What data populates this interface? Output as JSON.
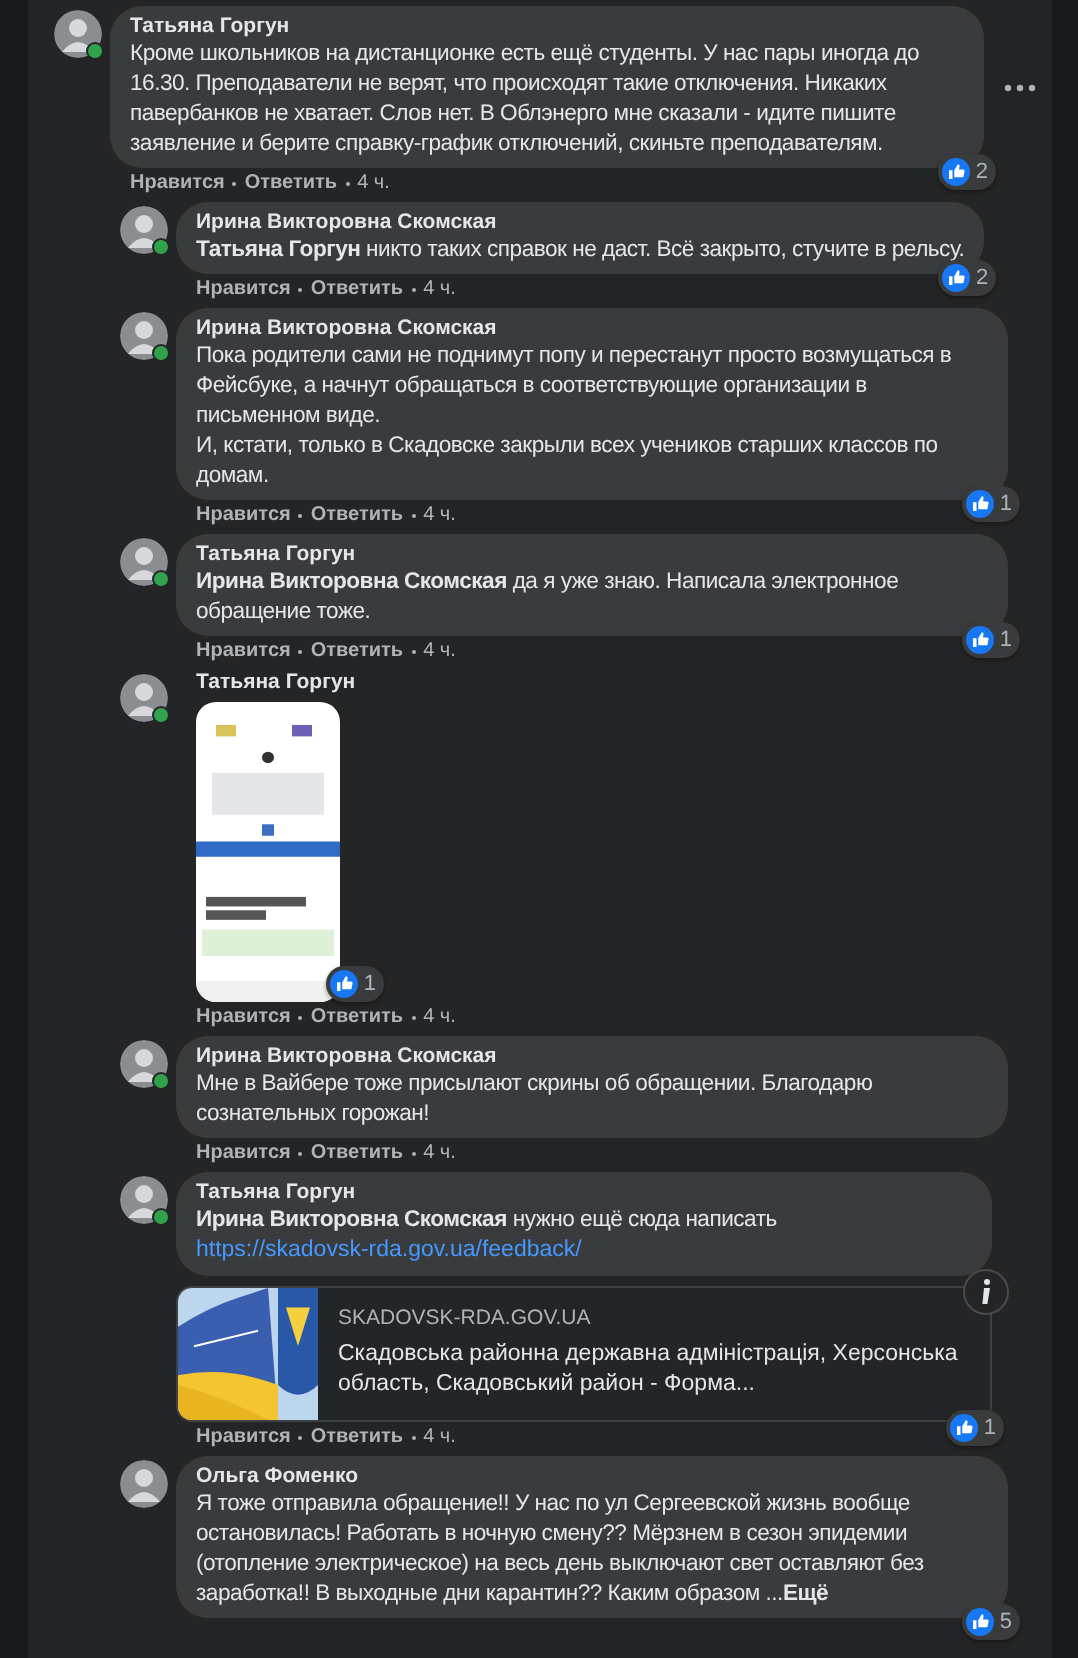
{
  "comments": [
    {
      "author": "Татьяна Горгун",
      "nested": false,
      "online": true,
      "text": "Кроме школьников на дистанционке есть ещё студенты. У нас пары иногда до 16.30. Преподаватели не верят, что происходят такие отключения. Никаких павербанков не хватает. Слов нет. В Облэнерго мне сказали - идите пишите заявление и берите справку-график отключений, скиньте преподавателям.",
      "more": true,
      "reactions": "2",
      "like": "Нравится",
      "reply": "Ответить",
      "time": "4 ч."
    },
    {
      "author": "Ирина Викторовна Скомская",
      "nested": true,
      "online": true,
      "text": "**Татьяна Горгун** никто таких справок не даст. Всё закрыто, стучите в рельсу.",
      "reactions": "2",
      "like": "Нравится",
      "reply": "Ответить",
      "time": "4 ч."
    },
    {
      "author": "Ирина Викторовна Скомская",
      "nested": true,
      "online": true,
      "text": "Пока родители сами не поднимут попу и перестанут просто возмущаться в Фейсбуке, а начнут обращаться в соответствующие организации в письменном виде.\nИ, кстати, только в Скадовске закрыли всех учеников старших классов по домам.",
      "reactions": "1",
      "like": "Нравится",
      "reply": "Ответить",
      "time": "4 ч."
    },
    {
      "author": "Татьяна Горгун",
      "nested": true,
      "online": true,
      "text": "**Ирина Викторовна Скомская** да я уже знаю. Написала электронное обращение тоже.",
      "reactions": "1",
      "like": "Нравится",
      "reply": "Ответить",
      "time": "4 ч."
    },
    {
      "author": "Татьяна Горгун",
      "nested": true,
      "online": true,
      "reactions": "1",
      "like": "Нравится",
      "reply": "Ответить",
      "time": "4 ч."
    },
    {
      "author": "Ирина Викторовна Скомская",
      "nested": true,
      "online": true,
      "text": "Мне в Вайбере тоже присылают скрины об обращении. Благодарю сознательных горожан!",
      "like": "Нравится",
      "reply": "Ответить",
      "time": "4 ч."
    },
    {
      "author": "Татьяна Горгун",
      "nested": true,
      "online": true,
      "text": "**Ирина Викторовна Скомская** нужно ещё сюда написать",
      "link": "https://skadovsk-rda.gov.ua/feedback/",
      "preview": {
        "domain": "SKADOVSK-RDA.GOV.UA",
        "title": "Скадовська районна державна адміністрація, Херсонська область, Скадовський район - Форма..."
      },
      "reactions": "1",
      "like": "Нравится",
      "reply": "Ответить",
      "time": "4 ч."
    },
    {
      "author": "Ольга Фоменко",
      "nested": true,
      "online": false,
      "text": "Я тоже отправила обращение!! У нас по ул Сергеевской жизнь вообще остановилась! Работать в ночную смену?? Мёрзнем в сезон эпидемии (отопление электрическое) на весь день выключают свет оставляют без заработка!! В выходные дни карантин?? Каким образом ...",
      "see_more": "Ещё",
      "reactions": "5"
    }
  ]
}
